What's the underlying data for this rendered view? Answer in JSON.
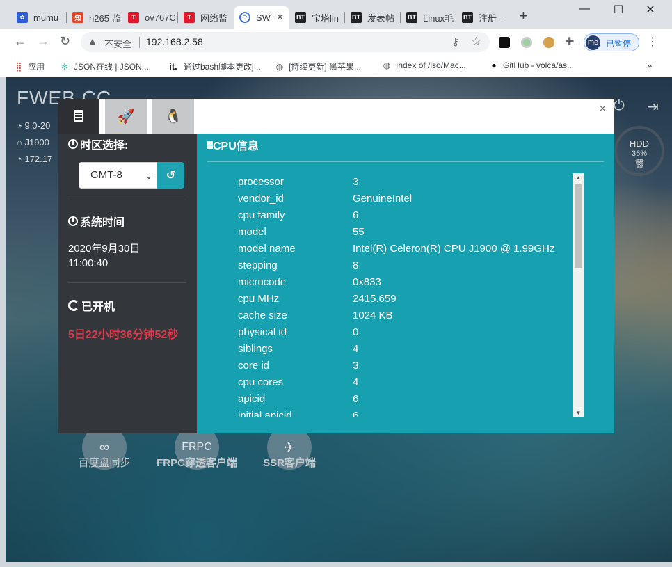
{
  "browser": {
    "tabs": [
      {
        "label": "mumu",
        "icon": "paw-icon",
        "color": "#3060d8"
      },
      {
        "label": "h265 监",
        "icon": "zhihu-icon",
        "color": "#e04a2a"
      },
      {
        "label": "ov767C",
        "icon": "t-icon",
        "color": "#e11a2b"
      },
      {
        "label": "网络监",
        "icon": "t-icon",
        "color": "#e11a2b"
      },
      {
        "label": "SW",
        "icon": "gauge-icon",
        "color": "#3a6fd8"
      },
      {
        "label": "宝塔lin",
        "icon": "bt-icon",
        "color": "#202124"
      },
      {
        "label": "发表帖",
        "icon": "bt-icon",
        "color": "#202124"
      },
      {
        "label": "Linux毛",
        "icon": "bt-icon",
        "color": "#202124"
      },
      {
        "label": "注册 - ",
        "icon": "bt-icon",
        "color": "#202124"
      }
    ],
    "address": {
      "insecure_label": "不安全",
      "url": "192.168.2.58"
    },
    "profile": {
      "avatar": "me",
      "status": "已暂停"
    },
    "bookmarks": [
      {
        "label": "应用",
        "icon": "apps-grid-icon"
      },
      {
        "label": "JSON在线 | JSON...",
        "icon": "json-icon"
      },
      {
        "label": "通过bash脚本更改j...",
        "icon": "it-icon"
      },
      {
        "label": "[持续更新] 黑苹果...",
        "icon": "globe-icon"
      },
      {
        "label": "Index of /iso/Mac...",
        "icon": "globe-icon"
      },
      {
        "label": "GitHub - volca/as...",
        "icon": "github-icon"
      }
    ],
    "more_label": "»"
  },
  "background": {
    "brand": "FWEB CC",
    "sys_lines": [
      "9.0-20",
      "J1900",
      "172.17"
    ],
    "hdd": {
      "label": "HDD",
      "percent": "36%"
    },
    "apps": [
      {
        "label": "百度盘同步",
        "icon": "sync-icon"
      },
      {
        "label": "FRPC穿透客户端",
        "icon": "frpc-icon",
        "glyph": "FRPC"
      },
      {
        "label": "SSR客户端",
        "icon": "ssr-icon"
      }
    ]
  },
  "modal": {
    "tabs": [
      "cpu-icon",
      "rocket-icon",
      "linux-icon"
    ],
    "close": "×",
    "timezone": {
      "heading": "时区选择:",
      "selected": "GMT-8"
    },
    "system_time": {
      "heading": "系统时间",
      "date": "2020年9月30日",
      "time": "11:00:40"
    },
    "uptime": {
      "heading": "已开机",
      "value": "5日22小时36分钟52秒",
      "color": "#e0394b"
    },
    "cpu": {
      "title": "CPU信息",
      "rows": [
        {
          "key": "processor",
          "value": "3"
        },
        {
          "key": "vendor_id",
          "value": "GenuineIntel"
        },
        {
          "key": "cpu family",
          "value": "6"
        },
        {
          "key": "model",
          "value": "55"
        },
        {
          "key": "model name",
          "value": "Intel(R) Celeron(R) CPU J1900 @ 1.99GHz"
        },
        {
          "key": "stepping",
          "value": "8"
        },
        {
          "key": "microcode",
          "value": "0x833"
        },
        {
          "key": "cpu MHz",
          "value": "2415.659"
        },
        {
          "key": "cache size",
          "value": "1024 KB"
        },
        {
          "key": "physical id",
          "value": "0"
        },
        {
          "key": "siblings",
          "value": "4"
        },
        {
          "key": "core id",
          "value": "3"
        },
        {
          "key": "cpu cores",
          "value": "4"
        },
        {
          "key": "apicid",
          "value": "6"
        },
        {
          "key": "initial apicid",
          "value": "6"
        }
      ]
    }
  }
}
